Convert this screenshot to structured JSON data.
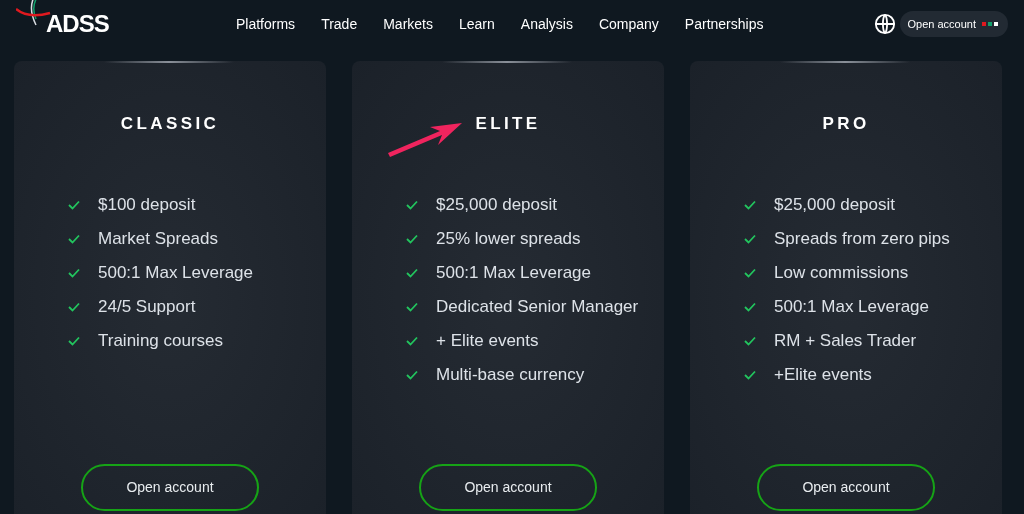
{
  "header": {
    "logo": "ADSS",
    "nav": [
      "Platforms",
      "Trade",
      "Markets",
      "Learn",
      "Analysis",
      "Company",
      "Partnerships"
    ],
    "cta": "Open account"
  },
  "plans": [
    {
      "title": "CLASSIC",
      "annotated": false,
      "features": [
        "$100 deposit",
        "Market Spreads",
        "500:1 Max Leverage",
        "24/5 Support",
        "Training courses"
      ],
      "button": "Open account"
    },
    {
      "title": "ELITE",
      "annotated": true,
      "features": [
        "$25,000 deposit",
        "25% lower spreads",
        "500:1 Max Leverage",
        "Dedicated Senior Manager",
        "+ Elite events",
        "Multi-base currency"
      ],
      "button": "Open account"
    },
    {
      "title": "PRO",
      "annotated": false,
      "features": [
        "$25,000 deposit",
        "Spreads from zero pips",
        "Low commissions",
        "500:1 Max Leverage",
        "RM + Sales Trader",
        "+Elite events"
      ],
      "button": "Open account"
    }
  ]
}
